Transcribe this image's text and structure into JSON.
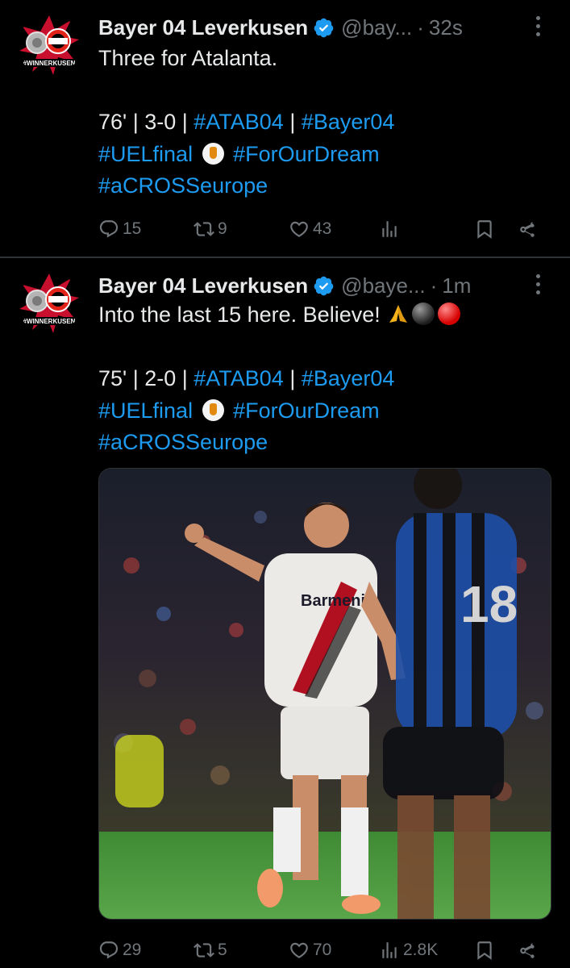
{
  "tweets": [
    {
      "author_name": "Bayer 04 Leverkusen",
      "handle": "@bay...",
      "separator": "·",
      "time": "32s",
      "text_lines": [
        "Three for Atalanta.",
        "",
        "76' | 3-0 | ",
        "",
        ""
      ],
      "line3_prefix": "76' | 3-0 | ",
      "line3_tag1": "#ATAB04",
      "line3_sep": " | ",
      "line3_tag2": "#Bayer04",
      "line4_tag1": "#UELfinal",
      "line4_tag2": "#ForOurDream",
      "line5_tag": "#aCROSSeurope",
      "stats": {
        "replies": "15",
        "retweets": "9",
        "likes": "43",
        "views": "",
        "bookmark": "",
        "share": ""
      }
    },
    {
      "author_name": "Bayer 04 Leverkusen",
      "handle": "@baye...",
      "separator": "·",
      "time": "1m",
      "line1": "Into the last 15 here. Believe! ",
      "line3_prefix": "75' | 2-0 | ",
      "line3_tag1": "#ATAB04",
      "line3_sep": " | ",
      "line3_tag2": "#Bayer04",
      "line4_tag1": "#UELfinal",
      "line4_tag2": "#ForOurDream",
      "line5_tag": "#aCROSSeurope",
      "stats": {
        "replies": "29",
        "retweets": "5",
        "likes": "70",
        "views": "2.8K"
      }
    }
  ],
  "avatar_text": "#WINNERKUSEN",
  "jersey_text": "Barmenia",
  "colors": {
    "background": "#000000",
    "text": "#e7e9ea",
    "muted": "#71767b",
    "link": "#1d9bf0",
    "verified": "#1d9bf0",
    "divider": "#2f3336"
  }
}
